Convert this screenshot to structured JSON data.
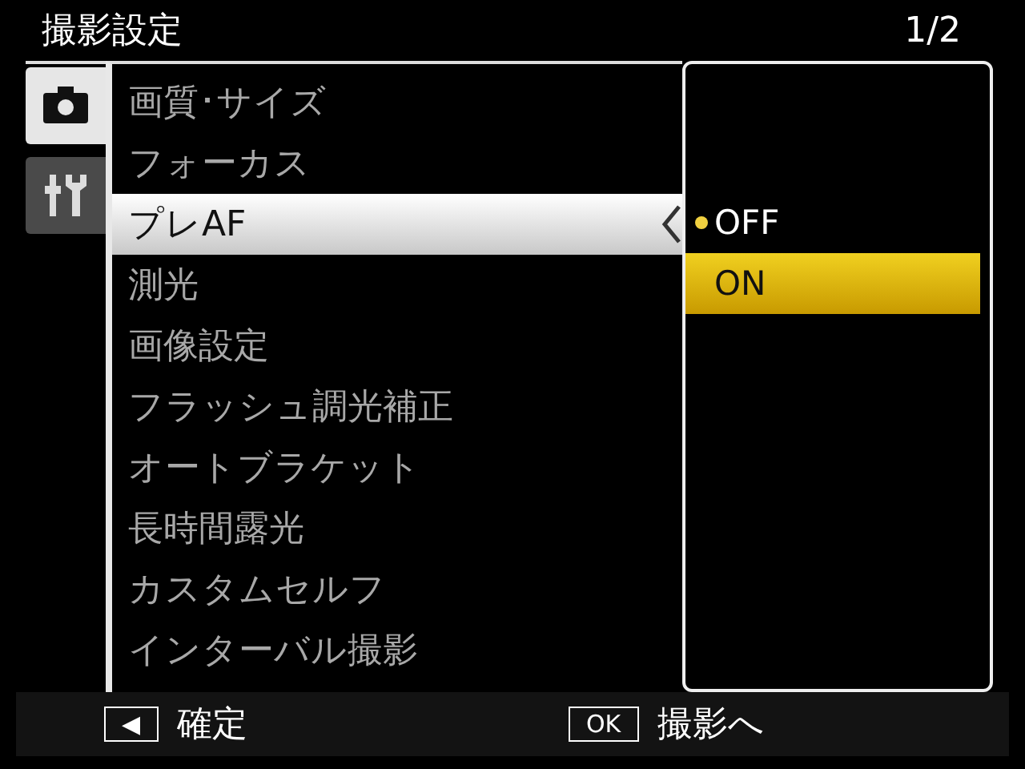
{
  "title": "撮影設定",
  "page": "1/2",
  "tabs": [
    {
      "kind": "camera",
      "selected": true
    },
    {
      "kind": "tools",
      "selected": false
    }
  ],
  "menu": [
    {
      "label": "画質･サイズ",
      "selected": false
    },
    {
      "label": "フォーカス",
      "selected": false
    },
    {
      "label": "プレAF",
      "selected": true
    },
    {
      "label": "測光",
      "selected": false
    },
    {
      "label": "画像設定",
      "selected": false
    },
    {
      "label": "フラッシュ調光補正",
      "selected": false
    },
    {
      "label": "オートブラケット",
      "selected": false
    },
    {
      "label": "長時間露光",
      "selected": false
    },
    {
      "label": "カスタムセルフ",
      "selected": false
    },
    {
      "label": "インターバル撮影",
      "selected": false
    }
  ],
  "options": [
    {
      "label": "OFF",
      "current": true,
      "selected": false
    },
    {
      "label": "ON",
      "current": false,
      "selected": true
    }
  ],
  "footer": [
    {
      "key": "◀",
      "label": "確定"
    },
    {
      "key": "OK",
      "label": "撮影へ"
    }
  ]
}
